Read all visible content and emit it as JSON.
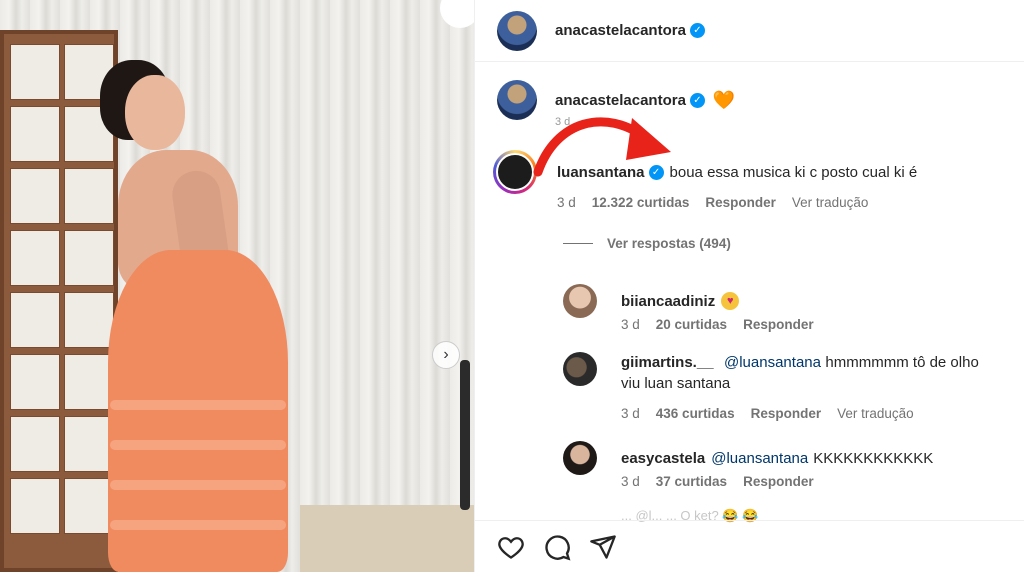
{
  "header": {
    "username": "anacastelacantora"
  },
  "caption": {
    "username": "anacastelacantora",
    "emoji": "🧡",
    "time": "3 d"
  },
  "comments": [
    {
      "username": "luansantana",
      "verified": true,
      "text": "boua essa musica ki c posto cual ki é",
      "time": "3 d",
      "likes": "12.322 curtidas",
      "reply": "Responder",
      "translate": "Ver tradução"
    },
    {
      "username": "biiancaadiniz",
      "emoji": "😍",
      "time": "3 d",
      "likes": "20 curtidas",
      "reply": "Responder"
    },
    {
      "username": "giimartins.__",
      "mention": "@luansantana",
      "text_line1": "hmmmmmm tô de olho",
      "text_line2": "viu luan santana",
      "time": "3 d",
      "likes": "436 curtidas",
      "reply": "Responder",
      "translate": "Ver tradução"
    },
    {
      "username": "easycastela",
      "mention": "@luansantana",
      "text": "KKKKKKKKKKKK",
      "time": "3 d",
      "likes": "37 curtidas",
      "reply": "Responder"
    }
  ],
  "view_replies": "Ver respostas (494)",
  "partial_comment": "... @l... ... O ket? 😂 😂",
  "actions": {
    "like_icon": "heart-icon",
    "comment_icon": "comment-icon",
    "share_icon": "send-icon"
  },
  "colors": {
    "verified": "#0095f6",
    "arrow": "#e8231a",
    "muted": "#737373",
    "mention": "#00376b"
  }
}
